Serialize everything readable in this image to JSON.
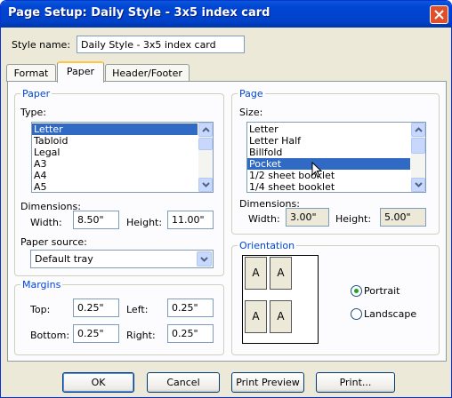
{
  "window": {
    "title": "Page Setup: Daily Style - 3x5 index card"
  },
  "style_name": {
    "label": "Style name:",
    "value": "Daily Style - 3x5 index card"
  },
  "tabs": [
    {
      "label": "Format"
    },
    {
      "label": "Paper"
    },
    {
      "label": "Header/Footer"
    }
  ],
  "paper": {
    "group_title": "Paper",
    "type_label": "Type:",
    "types": [
      "Letter",
      "Tabloid",
      "Legal",
      "A3",
      "A4",
      "A5"
    ],
    "selected_type": "Letter",
    "dimensions_label": "Dimensions:",
    "width_label": "Width:",
    "width_value": "8.50\"",
    "height_label": "Height:",
    "height_value": "11.00\"",
    "source_label": "Paper source:",
    "source_value": "Default tray"
  },
  "margins": {
    "group_title": "Margins",
    "top_label": "Top:",
    "top_value": "0.25\"",
    "left_label": "Left:",
    "left_value": "0.25\"",
    "bottom_label": "Bottom:",
    "bottom_value": "0.25\"",
    "right_label": "Right:",
    "right_value": "0.25\""
  },
  "page": {
    "group_title": "Page",
    "size_label": "Size:",
    "sizes": [
      "Letter",
      "Letter Half",
      "Billfold",
      "Pocket",
      "1/2 sheet booklet",
      "1/4 sheet booklet"
    ],
    "selected_size": "Pocket",
    "dimensions_label": "Dimensions:",
    "width_label": "Width:",
    "width_value": "3.00\"",
    "height_label": "Height:",
    "height_value": "5.00\""
  },
  "orientation": {
    "group_title": "Orientation",
    "card_letter": "A",
    "portrait_label": "Portrait",
    "landscape_label": "Landscape",
    "selected": "Portrait"
  },
  "buttons": {
    "ok": "OK",
    "cancel": "Cancel",
    "print_preview": "Print Preview",
    "print": "Print..."
  },
  "colors": {
    "titlebar": "#0046d5",
    "selection": "#316ac5",
    "group_title": "#0046d5",
    "tab_highlight": "#ffc83c"
  },
  "icons": {
    "close": "close-icon",
    "scroll_up": "chevron-up-icon",
    "scroll_down": "chevron-down-icon",
    "combo": "chevron-down-icon",
    "cursor": "mouse-pointer-icon"
  }
}
